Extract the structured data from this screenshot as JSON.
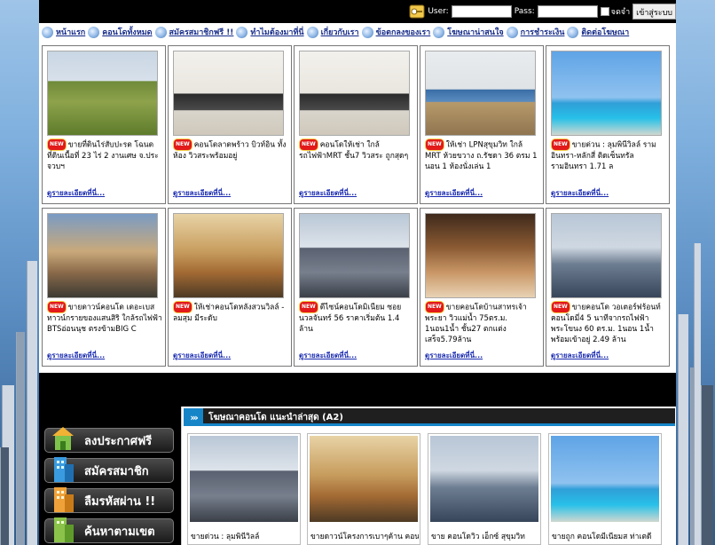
{
  "login": {
    "user_label": "User:",
    "pass_label": "Pass:",
    "remember_label": "จดจำ",
    "login_button": "เข้าสู่ระบบ"
  },
  "nav": {
    "items": [
      {
        "label": "หน้าแรก"
      },
      {
        "label": "คอนโดทั้งหมด"
      },
      {
        "label": "สมัครสมาชิกฟรี !!"
      },
      {
        "label": "ทำไมต้องมาที่นี่"
      },
      {
        "label": "เกี่ยวกับเรา"
      },
      {
        "label": "ข้อตกลงของเรา"
      },
      {
        "label": "โฆษณาน่าสนใจ"
      },
      {
        "label": "การชำระเงิน"
      },
      {
        "label": "ติดต่อโฆษณา"
      }
    ]
  },
  "listings": {
    "new_badge": "NEW",
    "more_label": "ดูรายละเอียดที่นี่...",
    "items": [
      {
        "text": "ขายที่ดินไร่สับปะรด โฉนด ที่ดินเนื้อที่ 23 ไร่ 2 งานเศษ จ.ประจวบฯ",
        "photo": "field"
      },
      {
        "text": "คอนโดลาดพร้าว บิวท์อิน ทั้งห้อง วิวสระพร้อมอยู่",
        "photo": "kitchen"
      },
      {
        "text": "คอนโดให้เช่า ใกล้รถไฟฟ้าMRT ชั้น7 วิวสระ ถูกสุดๆ",
        "photo": "kitchen"
      },
      {
        "text": "ให้เช่า LPNสุขุมวิท ใกล้ MRT ห้วยขวาง ถ.รัชดา 36 ตรม 1 นอน 1 ห้องนั่งเล่น 1",
        "photo": "livingblue"
      },
      {
        "text": "ขายด่วน : ลุมพินีวิลล์ ราม อินทรา-หลักสี่ ติดเซ็นทรัล รามอินทรา 1.71 ล",
        "photo": "tower"
      },
      {
        "text": "ขายดาวน์คอนโด เดอะเบส ทาวน์กรายของแสนสิริ ใกล้รถไฟฟ้า BTSอ่อนนุช ตรงข้ามBIG C",
        "photo": "render"
      },
      {
        "text": "ให้เช่าคอนโดหลังสวนวิลล์ - ลมสุม มีระดับ",
        "photo": "warm"
      },
      {
        "text": "ดีไซน์คอนโดมิเนียม ซอย นวลจันทร์ 56 ราคาเริ่มต้น 1.4 ล้าน",
        "photo": "bldg"
      },
      {
        "text": "ขายคอนโดบ้านสาทรเจ้า พระยา วิวแม่น้ำ 75ตร.ม. 1นอน1น้ำ ชั้น27 ตกแต่ง เสร็จ5.79ล้าน",
        "photo": "dining"
      },
      {
        "text": "ขายคอนโด วอเตอร์ฟร้อนท์ คอนโดมี่4 5 นาทีจากรถไฟฟ้า พระโขนง 60 ตร.ม. 1นอน 1น้ำ พร้อมเข้าอยู่ 2.49 ล้าน",
        "photo": "city"
      }
    ]
  },
  "side_menu": [
    {
      "label": "ลงประกาศฟรี",
      "icon": "house-icon"
    },
    {
      "label": "สมัครสมาชิก",
      "icon": "building-icon"
    },
    {
      "label": "ลืมรหัสผ่าน !!",
      "icon": "building-icon"
    },
    {
      "label": "ค้นหาตามเขต",
      "icon": "building-icon"
    }
  ],
  "recommended": {
    "title": "โฆษณาคอนโด แนะนำล่าสุด (A2)",
    "items": [
      {
        "text": "ขายด่วน : ลุมพินีวิลล์",
        "photo": "bldg"
      },
      {
        "text": "ขายดาวน์โครงการเบาๆค้าน คอน",
        "photo": "warm"
      },
      {
        "text": "ขาย คอนโดวิว เอ็กซ์ สุขุมวิท",
        "photo": "city"
      },
      {
        "text": "ขายถูก คอนโดมีเนียมส ท่าเตดี",
        "photo": "tower"
      }
    ]
  },
  "colors": {
    "nav_link": "#1a2f8a",
    "new_badge": "#e21a1a",
    "rec_accent": "#1585c8"
  }
}
